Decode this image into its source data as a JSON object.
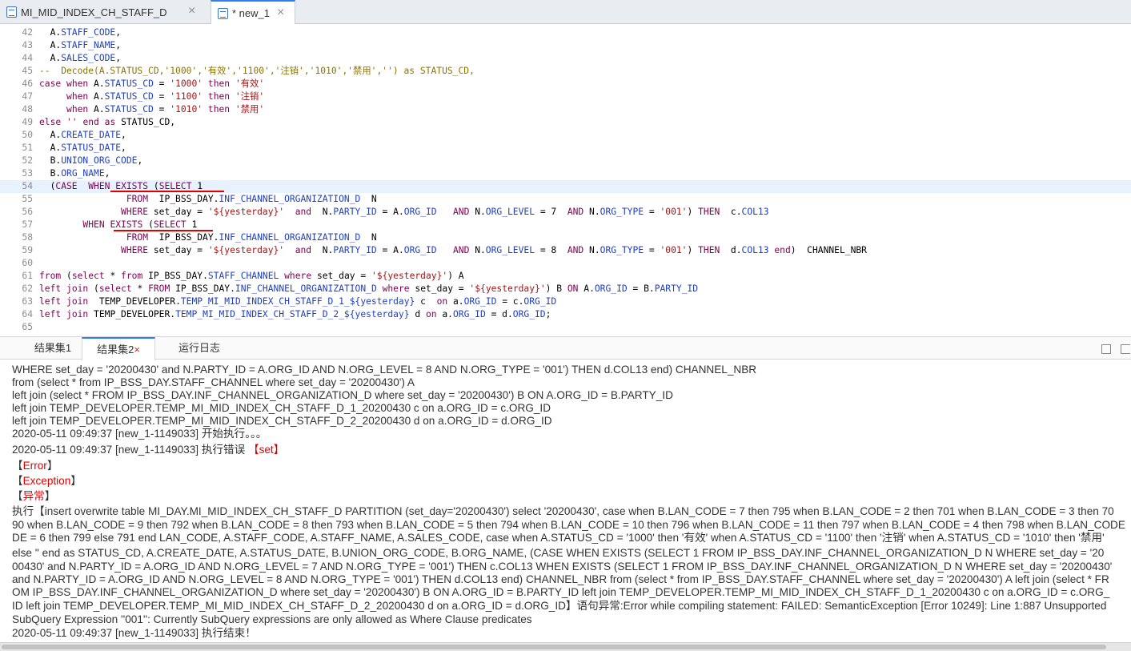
{
  "editor_tabs": [
    {
      "label": "MI_MID_INDEX_CH_STAFF_D",
      "close": "×"
    },
    {
      "label": "* new_1",
      "close": "×"
    }
  ],
  "code_lines": [
    {
      "n": "42",
      "t": "  A.STAFF_CODE,"
    },
    {
      "n": "43",
      "t": "  A.STAFF_NAME,"
    },
    {
      "n": "44",
      "t": "  A.SALES_CODE,"
    },
    {
      "n": "45",
      "t": "--  Decode(A.STATUS_CD,'1000','有效','1100','注销','1010','禁用','') as STATUS_CD,"
    },
    {
      "n": "46",
      "t": "case when A.STATUS_CD = '1000' then '有效'"
    },
    {
      "n": "47",
      "t": "     when A.STATUS_CD = '1100' then '注销'"
    },
    {
      "n": "48",
      "t": "     when A.STATUS_CD = '1010' then '禁用'"
    },
    {
      "n": "49",
      "t": "else '' end as STATUS_CD,"
    },
    {
      "n": "50",
      "t": "  A.CREATE_DATE,"
    },
    {
      "n": "51",
      "t": "  A.STATUS_DATE,"
    },
    {
      "n": "52",
      "t": "  B.UNION_ORG_CODE,"
    },
    {
      "n": "53",
      "t": "  B.ORG_NAME,"
    },
    {
      "n": "54",
      "t": "  (CASE  WHEN EXISTS (SELECT 1"
    },
    {
      "n": "55",
      "t": "                FROM  IP_BSS_DAY.INF_CHANNEL_ORGANIZATION_D  N"
    },
    {
      "n": "56",
      "t": "               WHERE set_day = '${yesterday}'  and  N.PARTY_ID = A.ORG_ID   AND N.ORG_LEVEL = 7  AND N.ORG_TYPE = '001') THEN  c.COL13"
    },
    {
      "n": "57",
      "t": "        WHEN EXISTS (SELECT 1"
    },
    {
      "n": "58",
      "t": "                FROM  IP_BSS_DAY.INF_CHANNEL_ORGANIZATION_D  N"
    },
    {
      "n": "59",
      "t": "               WHERE set_day = '${yesterday}'  and  N.PARTY_ID = A.ORG_ID   AND N.ORG_LEVEL = 8  AND N.ORG_TYPE = '001') THEN  d.COL13 end)  CHANNEL_NBR"
    },
    {
      "n": "60",
      "t": ""
    },
    {
      "n": "61",
      "t": "from (select * from IP_BSS_DAY.STAFF_CHANNEL where set_day = '${yesterday}') A"
    },
    {
      "n": "62",
      "t": "left join (select * FROM IP_BSS_DAY.INF_CHANNEL_ORGANIZATION_D where set_day = '${yesterday}') B ON A.ORG_ID = B.PARTY_ID"
    },
    {
      "n": "63",
      "t": "left join  TEMP_DEVELOPER.TEMP_MI_MID_INDEX_CH_STAFF_D_1_${yesterday} c  on a.ORG_ID = c.ORG_ID"
    },
    {
      "n": "64",
      "t": "left join TEMP_DEVELOPER.TEMP_MI_MID_INDEX_CH_STAFF_D_2_${yesterday} d on a.ORG_ID = d.ORG_ID;"
    },
    {
      "n": "65",
      "t": ""
    }
  ],
  "panel_tabs": {
    "result1": "结果集1",
    "result2": "结果集2",
    "result2_close": "×",
    "log": "运行日志"
  },
  "log_lines": [
    {
      "t": "WHERE set_day = '20200430' and N.PARTY_ID = A.ORG_ID AND N.ORG_LEVEL = 8 AND N.ORG_TYPE = '001') THEN d.COL13 end) CHANNEL_NBR"
    },
    {
      "t": "from (select * from IP_BSS_DAY.STAFF_CHANNEL where set_day = '20200430') A"
    },
    {
      "t": "left join (select * FROM IP_BSS_DAY.INF_CHANNEL_ORGANIZATION_D where set_day = '20200430') B ON A.ORG_ID = B.PARTY_ID"
    },
    {
      "t": "left join TEMP_DEVELOPER.TEMP_MI_MID_INDEX_CH_STAFF_D_1_20200430 c on a.ORG_ID = c.ORG_ID"
    },
    {
      "t": "left join TEMP_DEVELOPER.TEMP_MI_MID_INDEX_CH_STAFF_D_2_20200430 d on a.ORG_ID = d.ORG_ID"
    },
    {
      "t": "2020-05-11 09:49:37 [new_1-1149033] 开始执行。。。"
    },
    {
      "t": "2020-05-11 09:49:37 [new_1-1149033] 执行错误 ",
      "r": "【set】"
    },
    {
      "t": "【",
      "r": "Error",
      "t2": "】"
    },
    {
      "t": "【",
      "r": "Exception",
      "t2": "】"
    },
    {
      "t": "【",
      "r": "异常",
      "t2": "】"
    },
    {
      "t": "执行【insert overwrite table MI_DAY.MI_MID_INDEX_CH_STAFF_D PARTITION (set_day='20200430') select '20200430', case when B.LAN_CODE = 7 then 795 when B.LAN_CODE = 2 then 701 when B.LAN_CODE = 3 then 70"
    },
    {
      "t": "90 when B.LAN_CODE = 9 then 792 when B.LAN_CODE = 8 then 793 when B.LAN_CODE = 5 then 794 when B.LAN_CODE = 10 then 796 when B.LAN_CODE = 11 then 797 when B.LAN_CODE = 4 then 798 when B.LAN_CODE"
    },
    {
      "t": "DE = 6 then 799 else 791 end LAN_CODE, A.STAFF_CODE, A.STAFF_NAME, A.SALES_CODE, case when A.STATUS_CD = '1000' then '有效' when A.STATUS_CD = '1100' then '注销' when A.STATUS_CD = '1010' then '禁用'"
    },
    {
      "t": "else '' end as STATUS_CD, A.CREATE_DATE, A.STATUS_DATE, B.UNION_ORG_CODE, B.ORG_NAME, (CASE WHEN EXISTS (SELECT 1 FROM IP_BSS_DAY.INF_CHANNEL_ORGANIZATION_D N WHERE set_day = '20"
    },
    {
      "t": "00430' and N.PARTY_ID = A.ORG_ID AND N.ORG_LEVEL = 7 AND N.ORG_TYPE = '001') THEN c.COL13 WHEN EXISTS (SELECT 1 FROM IP_BSS_DAY.INF_CHANNEL_ORGANIZATION_D N WHERE set_day = '20200430'"
    },
    {
      "t": "and N.PARTY_ID = A.ORG_ID AND N.ORG_LEVEL = 8 AND N.ORG_TYPE = '001') THEN d.COL13 end) CHANNEL_NBR from (select * from IP_BSS_DAY.STAFF_CHANNEL where set_day = '20200430') A left join (select * FR"
    },
    {
      "t": "OM IP_BSS_DAY.INF_CHANNEL_ORGANIZATION_D where set_day = '20200430') B ON A.ORG_ID = B.PARTY_ID left join TEMP_DEVELOPER.TEMP_MI_MID_INDEX_CH_STAFF_D_1_20200430 c on a.ORG_ID = c.ORG_"
    },
    {
      "t": "ID left join TEMP_DEVELOPER.TEMP_MI_MID_INDEX_CH_STAFF_D_2_20200430 d on a.ORG_ID = d.ORG_ID】语句异常:Error while compiling statement: FAILED: SemanticException [Error 10249]: Line 1:887 Unsupported"
    },
    {
      "t": "SubQuery Expression ''001'': Currently SubQuery expressions are only allowed as Where Clause predicates"
    },
    {
      "t": "2020-05-11 09:49:37 [new_1-1149033] 执行结束！"
    }
  ]
}
